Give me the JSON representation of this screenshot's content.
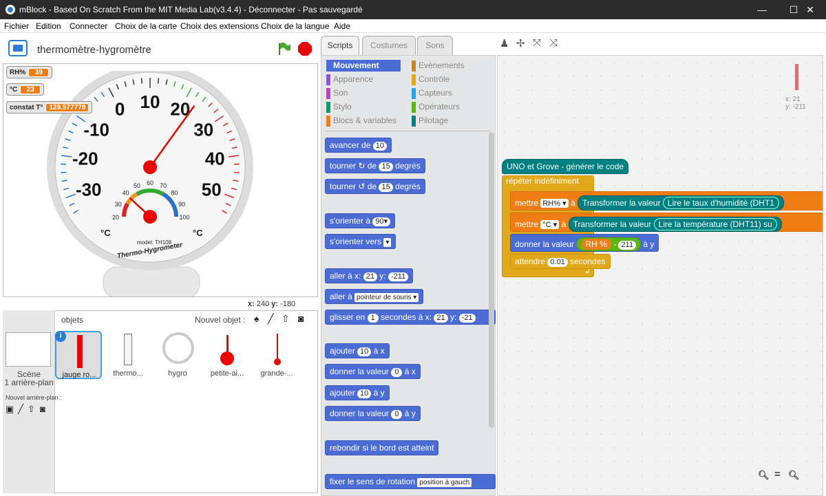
{
  "window": {
    "title": "mBlock - Based On Scratch From the MIT Media Lab(v3.4.4) - Déconnecter - Pas sauvegardé",
    "minimize": "—",
    "maximize": "☐",
    "close": "✕"
  },
  "menu": [
    "Fichier",
    "Edition",
    "Connecter",
    "Choix de la carte",
    "Choix des extensions",
    "Choix de la langue",
    "Aide"
  ],
  "stage": {
    "title": "thermomètre-hygromètre",
    "coords_x_label": "x:",
    "coords_x": "240",
    "coords_y_label": "y:",
    "coords_y": "-180"
  },
  "monitors": [
    {
      "label": "RH%",
      "value": "39"
    },
    {
      "label": "°C",
      "value": "23"
    },
    {
      "label": "constat T°",
      "value": "129.577778"
    }
  ],
  "gauge": {
    "temp_ticks": [
      "-30",
      "-20",
      "-10",
      "0",
      "10",
      "20",
      "30",
      "40",
      "50"
    ],
    "hum_ticks": [
      "20",
      "30",
      "40",
      "50",
      "60",
      "70",
      "80",
      "90",
      "100"
    ],
    "unit_left": "°C",
    "unit_right": "°C",
    "model": "model: TH108",
    "brand": "Thermo-Hygrometer",
    "hum_value": "39",
    "temp_value": "23"
  },
  "sprites": {
    "header": "objets",
    "new_sprite": "Nouvel objet :",
    "scene_label": "Scène",
    "scene_sub": "1 arrière-plan",
    "new_backdrop": "Nouvel arrière-plan :",
    "items": [
      "jauge ro...",
      "thermo...",
      "hygro",
      "petite-ai...",
      "grande-..."
    ]
  },
  "tabs": [
    "Scripts",
    "Costumes",
    "Sons"
  ],
  "categories": {
    "left": [
      "Mouvement",
      "Apparence",
      "Son",
      "Stylo",
      "Blocs & variables"
    ],
    "right": [
      "Evènements",
      "Contrôle",
      "Capteurs",
      "Opérateurs",
      "Pilotage"
    ],
    "left_colors": [
      "#4a6cd4",
      "#8a55d7",
      "#bb42c3",
      "#0e9a6c",
      "#ee7d16"
    ],
    "right_colors": [
      "#c88330",
      "#e1a91a",
      "#2ca5e2",
      "#5cb712",
      "#008080"
    ]
  },
  "palette": {
    "b1": {
      "a": "avancer de",
      "n": "10"
    },
    "b2": {
      "a": "tourner",
      "b": "de",
      "n": "15",
      "c": "degrés"
    },
    "b3": {
      "a": "tourner",
      "b": "de",
      "n": "15",
      "c": "degrés"
    },
    "b4": {
      "a": "s'orienter à",
      "n": "90▾"
    },
    "b5": {
      "a": "s'orienter vers",
      "d": "▾"
    },
    "b6": {
      "a": "aller à x:",
      "n1": "21",
      "b": "y:",
      "n2": "-211"
    },
    "b7": {
      "a": "aller à",
      "d": "pointeur de souris ▾"
    },
    "b8": {
      "a": "glisser en",
      "n1": "1",
      "b": "secondes à x:",
      "n2": "21",
      "c": "y:",
      "n3": "-21"
    },
    "b9": {
      "a": "ajouter",
      "n": "10",
      "b": "à x"
    },
    "b10": {
      "a": "donner la valeur",
      "n": "0",
      "b": "à x"
    },
    "b11": {
      "a": "ajouter",
      "n": "10",
      "b": "à y"
    },
    "b12": {
      "a": "donner la valeur",
      "n": "0",
      "b": "à y"
    },
    "b13": {
      "a": "rebondir si le bord est atteint"
    },
    "b14": {
      "a": "fixer le sens de rotation",
      "d": "position à gauch"
    }
  },
  "script": {
    "hat": "UNO et Grove - générer le code",
    "loop": "répéter indéfiniment",
    "s1": {
      "a": "mettre",
      "var": "RH% ▾",
      "b": "à",
      "op": "Transformer la valeur",
      "read": "Lire le taux d'humidité (DHT1"
    },
    "s2": {
      "a": "mettre",
      "var": "°C ▾",
      "b": "à",
      "op": "Transformer la valeur",
      "read": "Lire la température (DHT11) su"
    },
    "s3": {
      "a": "donner la valeur",
      "var": "RH %",
      "minus": "-",
      "n": "211",
      "b": "à y"
    },
    "s4": {
      "a": "attendre",
      "n": "0.01",
      "b": "secondes"
    },
    "loop_end": "↲"
  },
  "sprite_info": {
    "x": "x: 21",
    "y": "y: -211"
  },
  "zoom": {
    "out": "🔍−",
    "reset": "=",
    "in": "🔍+"
  }
}
